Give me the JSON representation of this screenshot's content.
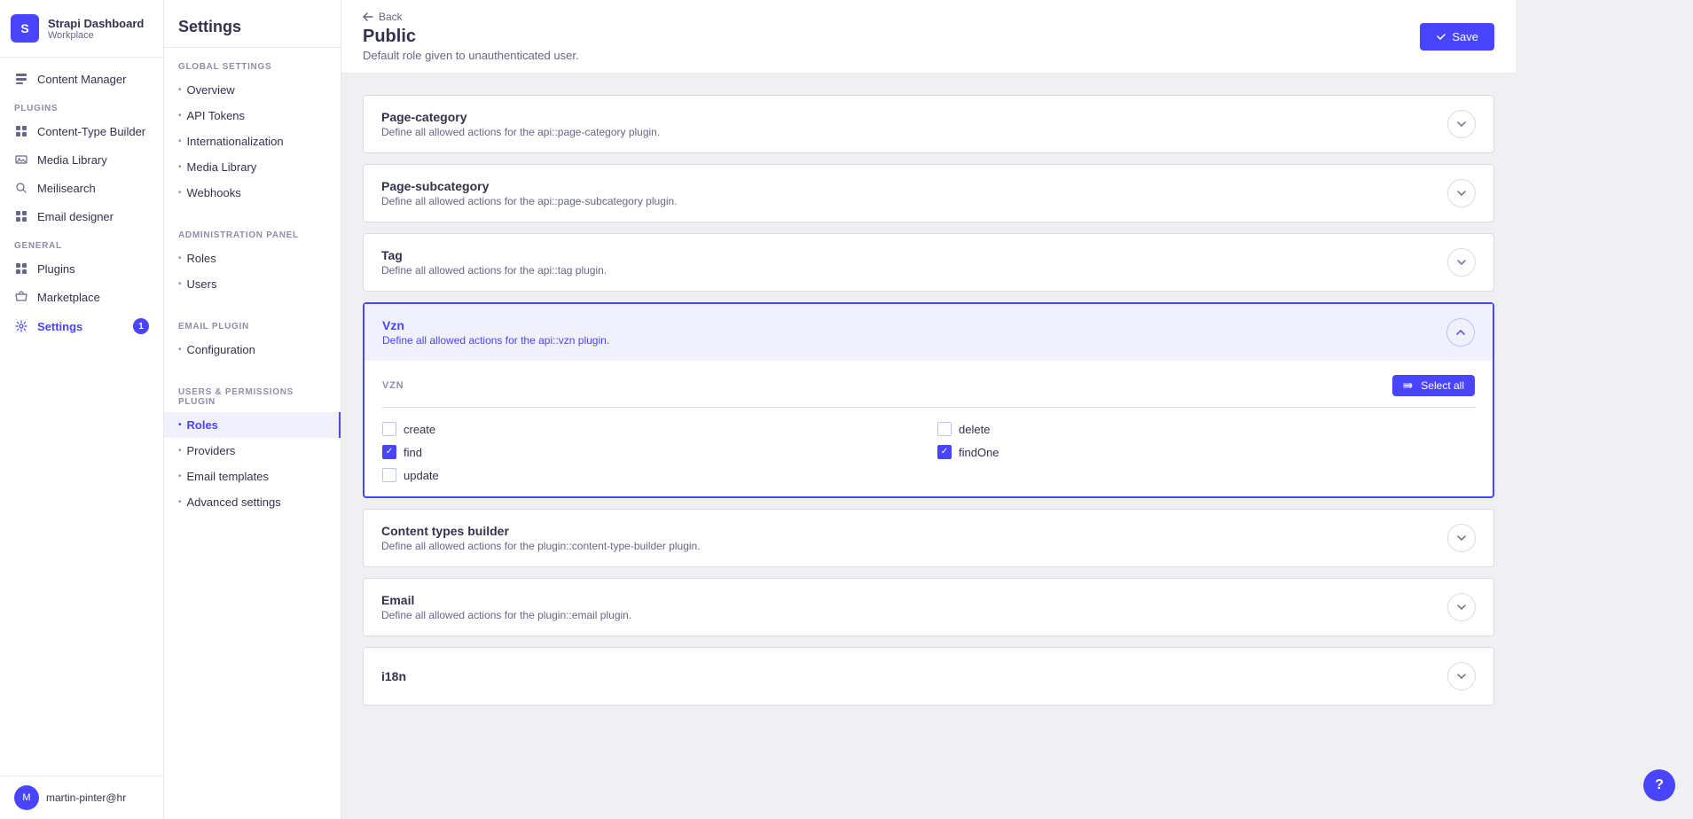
{
  "brand": {
    "icon": "S",
    "title": "Strapi Dashboard",
    "subtitle": "Workplace"
  },
  "sidebar": {
    "sections": [
      {
        "label": "",
        "items": [
          {
            "id": "content-manager",
            "label": "Content Manager",
            "icon": "📄",
            "active": false
          }
        ]
      },
      {
        "label": "PLUGINS",
        "items": [
          {
            "id": "content-type-builder",
            "label": "Content-Type Builder",
            "icon": "🧩",
            "active": false
          },
          {
            "id": "media-library",
            "label": "Media Library",
            "icon": "🖼",
            "active": false
          },
          {
            "id": "meilisearch",
            "label": "Meilisearch",
            "icon": "🔍",
            "active": false
          },
          {
            "id": "email-designer",
            "label": "Email designer",
            "icon": "🧩",
            "active": false
          }
        ]
      },
      {
        "label": "GENERAL",
        "items": [
          {
            "id": "plugins",
            "label": "Plugins",
            "icon": "🧩",
            "active": false
          },
          {
            "id": "marketplace",
            "label": "Marketplace",
            "icon": "🛒",
            "active": false
          },
          {
            "id": "settings",
            "label": "Settings",
            "icon": "⚙",
            "active": true,
            "badge": "1"
          }
        ]
      }
    ],
    "footer": {
      "user": "martin-pinter@hr",
      "avatar_initials": "M"
    }
  },
  "settings_panel": {
    "title": "Settings",
    "sections": [
      {
        "label": "GLOBAL SETTINGS",
        "items": [
          {
            "id": "overview",
            "label": "Overview",
            "active": false
          },
          {
            "id": "api-tokens",
            "label": "API Tokens",
            "active": false
          },
          {
            "id": "internationalization",
            "label": "Internationalization",
            "active": false
          },
          {
            "id": "media-library",
            "label": "Media Library",
            "active": false
          },
          {
            "id": "webhooks",
            "label": "Webhooks",
            "active": false
          }
        ]
      },
      {
        "label": "ADMINISTRATION PANEL",
        "items": [
          {
            "id": "roles",
            "label": "Roles",
            "active": false
          },
          {
            "id": "users",
            "label": "Users",
            "active": false
          }
        ]
      },
      {
        "label": "EMAIL PLUGIN",
        "items": [
          {
            "id": "configuration",
            "label": "Configuration",
            "active": false
          }
        ]
      },
      {
        "label": "USERS & PERMISSIONS PLUGIN",
        "items": [
          {
            "id": "roles-up",
            "label": "Roles",
            "active": true
          },
          {
            "id": "providers",
            "label": "Providers",
            "active": false
          },
          {
            "id": "email-templates",
            "label": "Email templates",
            "active": false
          },
          {
            "id": "advanced-settings",
            "label": "Advanced settings",
            "active": false
          }
        ]
      }
    ]
  },
  "page": {
    "back_label": "Back",
    "title": "Public",
    "subtitle": "Default role given to unauthenticated user.",
    "save_label": "Save"
  },
  "plugins": [
    {
      "id": "page-category",
      "title": "Page-category",
      "subtitle": "Define all allowed actions for the api::page-category plugin.",
      "expanded": false
    },
    {
      "id": "page-subcategory",
      "title": "Page-subcategory",
      "subtitle": "Define all allowed actions for the api::page-subcategory plugin.",
      "expanded": false
    },
    {
      "id": "tag",
      "title": "Tag",
      "subtitle": "Define all allowed actions for the api::tag plugin.",
      "expanded": false
    },
    {
      "id": "vzn",
      "title": "Vzn",
      "subtitle": "Define all allowed actions for the api::vzn plugin.",
      "expanded": true,
      "section_label": "VZN",
      "select_all_label": "Select all",
      "permissions": [
        {
          "id": "create",
          "label": "create",
          "checked": false
        },
        {
          "id": "delete",
          "label": "delete",
          "checked": false
        },
        {
          "id": "find",
          "label": "find",
          "checked": true
        },
        {
          "id": "findOne",
          "label": "findOne",
          "checked": true
        },
        {
          "id": "update",
          "label": "update",
          "checked": false
        }
      ]
    },
    {
      "id": "content-types-builder",
      "title": "Content types builder",
      "subtitle": "Define all allowed actions for the plugin::content-type-builder plugin.",
      "expanded": false
    },
    {
      "id": "email",
      "title": "Email",
      "subtitle": "Define all allowed actions for the plugin::email plugin.",
      "expanded": false
    },
    {
      "id": "i18n",
      "title": "i18n",
      "subtitle": "",
      "expanded": false
    }
  ]
}
